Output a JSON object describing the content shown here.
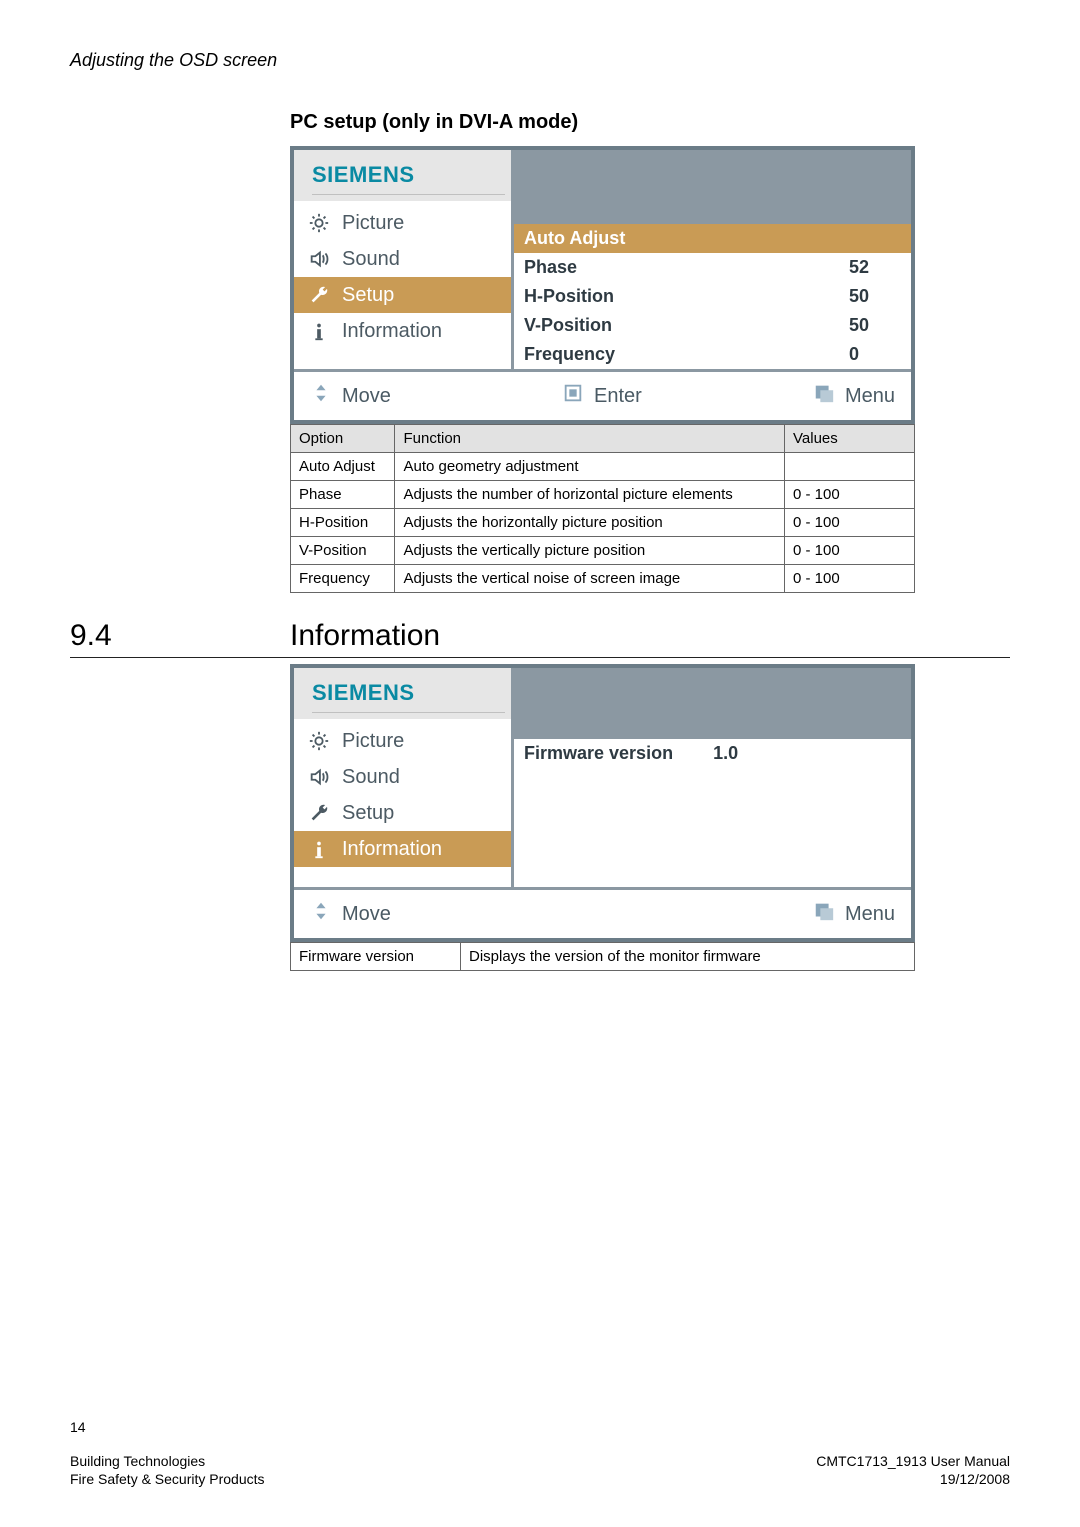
{
  "header": {
    "title": "Adjusting the OSD screen"
  },
  "subsection1": {
    "title": "PC setup (only in DVI-A mode)"
  },
  "osd1": {
    "brand": "SIEMENS",
    "menu": [
      {
        "label": "Picture",
        "icon": "brightness"
      },
      {
        "label": "Sound",
        "icon": "speaker"
      },
      {
        "label": "Setup",
        "icon": "wrench",
        "selected": true
      },
      {
        "label": "Information",
        "icon": "info"
      }
    ],
    "settings": [
      {
        "label": "Auto Adjust",
        "value": "",
        "highlight": true
      },
      {
        "label": "Phase",
        "value": "52"
      },
      {
        "label": "H-Position",
        "value": "50"
      },
      {
        "label": "V-Position",
        "value": "50"
      },
      {
        "label": "Frequency",
        "value": "0"
      }
    ],
    "footer": {
      "move": "Move",
      "enter": "Enter",
      "menu": "Menu"
    }
  },
  "table1": {
    "headers": {
      "option": "Option",
      "function": "Function",
      "values": "Values"
    },
    "rows": [
      {
        "option": "Auto Adjust",
        "function": "Auto geometry adjustment",
        "values": ""
      },
      {
        "option": "Phase",
        "function": "Adjusts the number of horizontal picture elements",
        "values": "0 - 100"
      },
      {
        "option": "H-Position",
        "function": "Adjusts the horizontally picture position",
        "values": "0 - 100"
      },
      {
        "option": "V-Position",
        "function": "Adjusts the vertically picture position",
        "values": "0 - 100"
      },
      {
        "option": "Frequency",
        "function": "Adjusts the vertical noise of screen image",
        "values": "0 - 100"
      }
    ]
  },
  "section2": {
    "number": "9.4",
    "title": "Information"
  },
  "osd2": {
    "brand": "SIEMENS",
    "menu": [
      {
        "label": "Picture",
        "icon": "brightness"
      },
      {
        "label": "Sound",
        "icon": "speaker"
      },
      {
        "label": "Setup",
        "icon": "wrench"
      },
      {
        "label": "Information",
        "icon": "info",
        "selected": true
      }
    ],
    "info": {
      "label": "Firmware version",
      "value": "1.0"
    },
    "footer": {
      "move": "Move",
      "menu": "Menu"
    }
  },
  "table2": {
    "rows": [
      {
        "option": "Firmware version",
        "function": "Displays the version of the monitor firmware"
      }
    ]
  },
  "footer": {
    "page": "14",
    "left1": "Building Technologies",
    "left2": "Fire Safety & Security Products",
    "right1": "CMTC1713_1913 User Manual",
    "right2": "19/12/2008"
  }
}
